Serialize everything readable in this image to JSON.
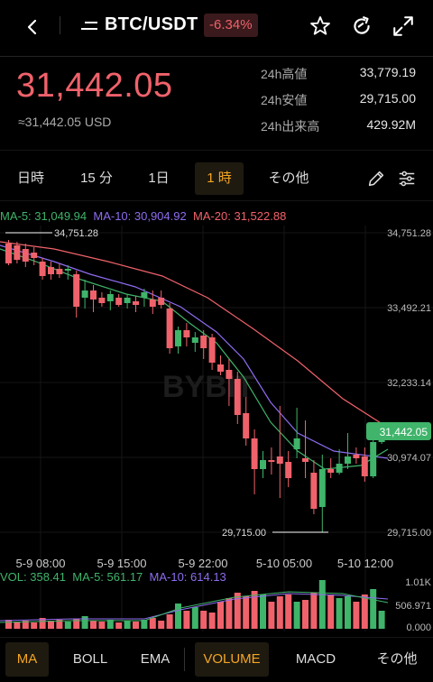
{
  "header": {
    "back_icon": "chevron-left-icon",
    "pair": "BTC/USDT",
    "change": "-6.34%",
    "icons": [
      "star-icon",
      "refresh-icon",
      "expand-icon"
    ]
  },
  "ticker": {
    "last_price": "31,442.05",
    "usd_price": "≈31,442.05 USD",
    "high_label": "24h高値",
    "high_value": "33,779.19",
    "low_label": "24h安値",
    "low_value": "29,715.00",
    "vol_label": "24h出来高",
    "vol_value": "429.92M"
  },
  "interval_tabs": {
    "t1": "日時",
    "t2": "15 分",
    "t3": "1日",
    "t4": "1 時",
    "t5": "その他",
    "active": "1 時"
  },
  "ma_legend": {
    "ma5": "MA-5: 31,049.94",
    "ma10": "MA-10: 30,904.92",
    "ma20": "MA-20: 31,522.88"
  },
  "price_axis": {
    "p1": "34,751.28",
    "p2": "33,492.21",
    "p3": "32,233.14",
    "p4": "30,974.07",
    "p5": "29,715.00",
    "last_tag": "31,442.05",
    "max_marker": "34,751.28",
    "min_marker": "29,715.00"
  },
  "time_axis": {
    "t1": "5-9 08:00",
    "t2": "5-9 15:00",
    "t3": "5-9 22:00",
    "t4": "5-10 05:00",
    "t5": "5-10 12:00"
  },
  "watermark": "BYBIT",
  "vol_legend": {
    "vol": "VOL: 358.41",
    "ma5": "MA-5: 561.17",
    "ma10": "MA-10: 614.13"
  },
  "vol_axis": {
    "top": "1.01K",
    "mid": "506.971",
    "bottom": "0.000"
  },
  "indicator_tabs": {
    "ma": "MA",
    "boll": "BOLL",
    "ema": "EMA",
    "volume": "VOLUME",
    "macd": "MACD",
    "more": "その他"
  },
  "colors": {
    "up": "#3fb46a",
    "down": "#f0626b",
    "ma5": "#3fb46a",
    "ma10": "#8e6cf0",
    "ma20": "#f0626b",
    "accent": "#f5a623"
  }
}
